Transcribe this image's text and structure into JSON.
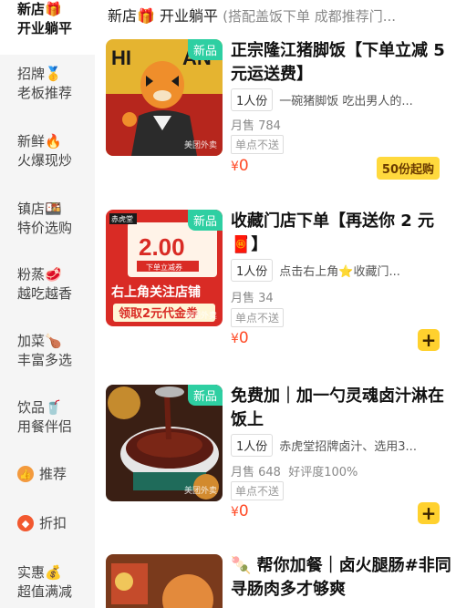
{
  "header": {
    "title": "新店🎁 开业躺平",
    "subtitle": "(搭配盖饭下单 成都推荐门..."
  },
  "sidebar": {
    "categories": [
      {
        "line1": "新店🎁",
        "line2": "开业躺平"
      },
      {
        "line1": "招牌🥇",
        "line2": "老板推荐"
      },
      {
        "line1": "新鲜🔥",
        "line2": "火爆现炒"
      },
      {
        "line1": "镇店🍱",
        "line2": "特价选购"
      },
      {
        "line1": "粉蒸🥩",
        "line2": "越吃越香"
      },
      {
        "line1": "加菜🍗",
        "line2": "丰富多选"
      },
      {
        "line1": "饮品🥤",
        "line2": "用餐伴侣"
      },
      {
        "line1": "推荐"
      },
      {
        "line1": "折扣"
      },
      {
        "line1": "实惠💰",
        "line2": "超值满减"
      }
    ]
  },
  "products": [
    {
      "badge": "新品",
      "title": "正宗隆江猪脚饭【下单立减 5 元运送费】",
      "spec": "1人份",
      "desc": "一碗猪脚饭 吃出男人的...",
      "sold": "月售 784",
      "tag": "单点不送",
      "currency": "¥",
      "price": "0",
      "min_order": "50份起购",
      "watermark": "美团外卖"
    },
    {
      "badge": "新品",
      "title": "收藏门店下单【再送你 2 元🧧】",
      "spec": "1人份",
      "desc": "点击右上角⭐收藏门...",
      "sold": "月售 34",
      "tag": "单点不送",
      "currency": "¥",
      "price": "0",
      "add": "+",
      "watermark": "美团外卖",
      "img_brand": "赤虎堂",
      "img_amount": "2.00",
      "img_coupon": "下单立减券",
      "img_line1": "右上角关注店铺",
      "img_line2": "领取2元代金券"
    },
    {
      "badge": "新品",
      "title": "免费加｜加一勺灵魂卤汁淋在饭上",
      "spec": "1人份",
      "desc": "赤虎堂招牌卤汁、选用3...",
      "sold": "月售 648",
      "rating": "好评度100%",
      "tag": "单点不送",
      "currency": "¥",
      "price": "0",
      "add": "+",
      "watermark": "美团外卖"
    },
    {
      "title": "🍡 帮你加餐｜卤火腿肠#非同寻肠肉多才够爽"
    }
  ],
  "colors": {
    "accent_green": "#2ecfa2",
    "price_red": "#ff4a26",
    "button_yellow": "#ffd12e"
  }
}
